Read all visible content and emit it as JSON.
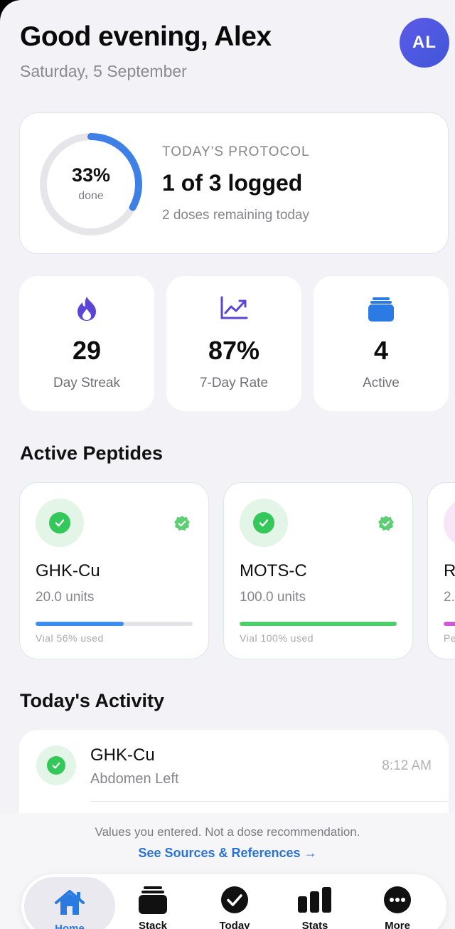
{
  "header": {
    "greeting": "Good evening, Alex",
    "date": "Saturday, 5 September",
    "avatar_initials": "AL"
  },
  "protocol": {
    "percent_label": "33%",
    "percent_sub": "done",
    "progress_fraction": 0.33,
    "label": "TODAY'S PROTOCOL",
    "title": "1 of 3 logged",
    "subtitle": "2 doses remaining today"
  },
  "stats": [
    {
      "icon": "flame-icon",
      "value": "29",
      "label": "Day Streak"
    },
    {
      "icon": "trend-chart-icon",
      "value": "87%",
      "label": "7-Day Rate"
    },
    {
      "icon": "stack-icon",
      "value": "4",
      "label": "Active"
    }
  ],
  "peptides_section": {
    "title": "Active Peptides",
    "items": [
      {
        "name": "GHK-Cu",
        "units": "20.0 units",
        "vial_label": "Vial 56% used",
        "vial_fraction": 0.56,
        "color": "#3b8ef0"
      },
      {
        "name": "MOTS-C",
        "units": "100.0 units",
        "vial_label": "Vial 100% used",
        "vial_fraction": 1.0,
        "color": "#4ccf6a"
      },
      {
        "name": "R",
        "units": "2.",
        "vial_label": "Pe",
        "vial_fraction": 0.4,
        "color": "#cc5ad8"
      }
    ]
  },
  "activity_section": {
    "title": "Today's Activity",
    "items": [
      {
        "name": "GHK-Cu",
        "site": "Abdomen Left",
        "time": "8:12 AM"
      }
    ]
  },
  "footer": {
    "disclaimer": "Values you entered. Not a dose recommendation.",
    "sources_link": "See Sources & References →"
  },
  "tabs": [
    {
      "label": "Home",
      "icon": "home-icon",
      "active": true
    },
    {
      "label": "Stack",
      "icon": "stack-icon"
    },
    {
      "label": "Today",
      "icon": "check-circle-icon"
    },
    {
      "label": "Stats",
      "icon": "bar-chart-icon"
    },
    {
      "label": "More",
      "icon": "more-icon"
    }
  ],
  "colors": {
    "accent": "#2a7ae2",
    "success": "#34c759",
    "ring_progress": "#3f80e6",
    "avatar": "#4f59e0"
  }
}
